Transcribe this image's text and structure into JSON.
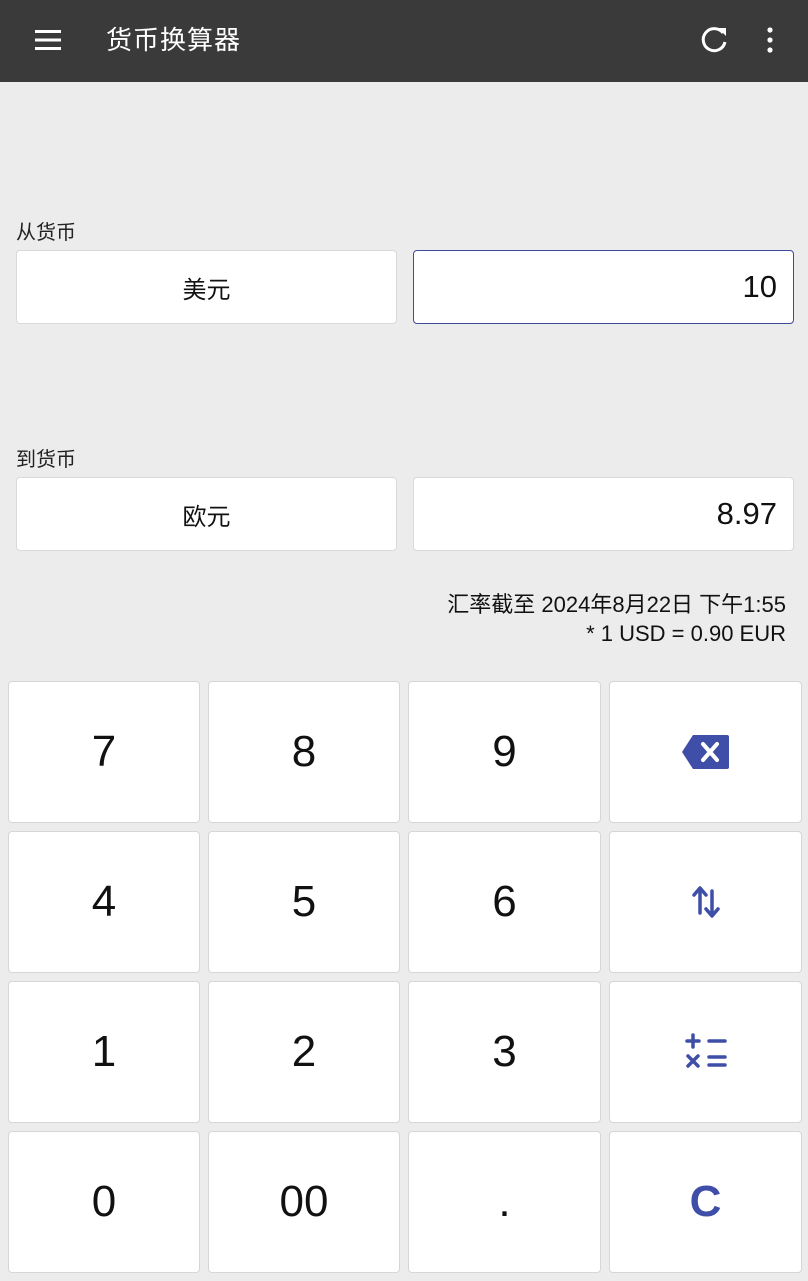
{
  "appbar": {
    "title": "货币换算器",
    "icons": [
      "menu-icon",
      "refresh-icon",
      "more-vert-icon"
    ]
  },
  "from": {
    "label": "从货币",
    "currency": "美元",
    "amount": "10"
  },
  "to": {
    "label": "到货币",
    "currency": "欧元",
    "amount": "8.97"
  },
  "rate": {
    "updated": "汇率截至 2024年8月22日 下午1:55",
    "conversion": "* 1 USD = 0.90 EUR"
  },
  "keypad": {
    "k7": "7",
    "k8": "8",
    "k9": "9",
    "k4": "4",
    "k5": "5",
    "k6": "6",
    "k1": "1",
    "k2": "2",
    "k3": "3",
    "k0": "0",
    "k00": "00",
    "kdot": ".",
    "clear": "C",
    "icons": [
      "backspace-icon",
      "swap-icon",
      "calculator-icon"
    ]
  },
  "colors": {
    "appbar_bg": "#3a3a3a",
    "accent": "#3f4fa8",
    "background": "#ececec"
  }
}
